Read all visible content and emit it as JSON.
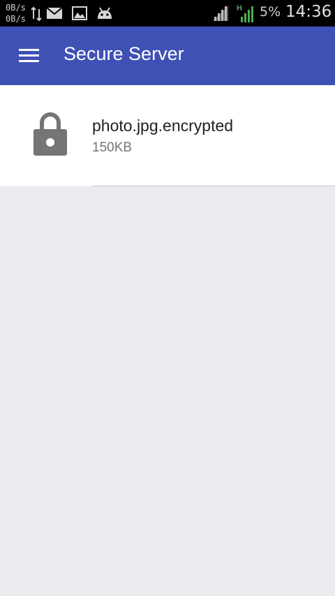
{
  "status_bar": {
    "upload_speed": "0B/s",
    "download_speed": "0B/s",
    "network_type": "H",
    "battery": "5%",
    "time": "14:36",
    "icons": [
      "data-transfer-icon",
      "mail-icon",
      "image-icon",
      "android-icon",
      "signal-icon",
      "signal-h-icon"
    ]
  },
  "app_bar": {
    "title": "Secure Server",
    "color": "#3f51b5"
  },
  "files": [
    {
      "name": "photo.jpg.encrypted",
      "size": "150KB",
      "icon": "lock-icon"
    }
  ],
  "colors": {
    "background": "#ebecf0",
    "lock_icon": "#757575",
    "signal_active": "#4caf50"
  }
}
